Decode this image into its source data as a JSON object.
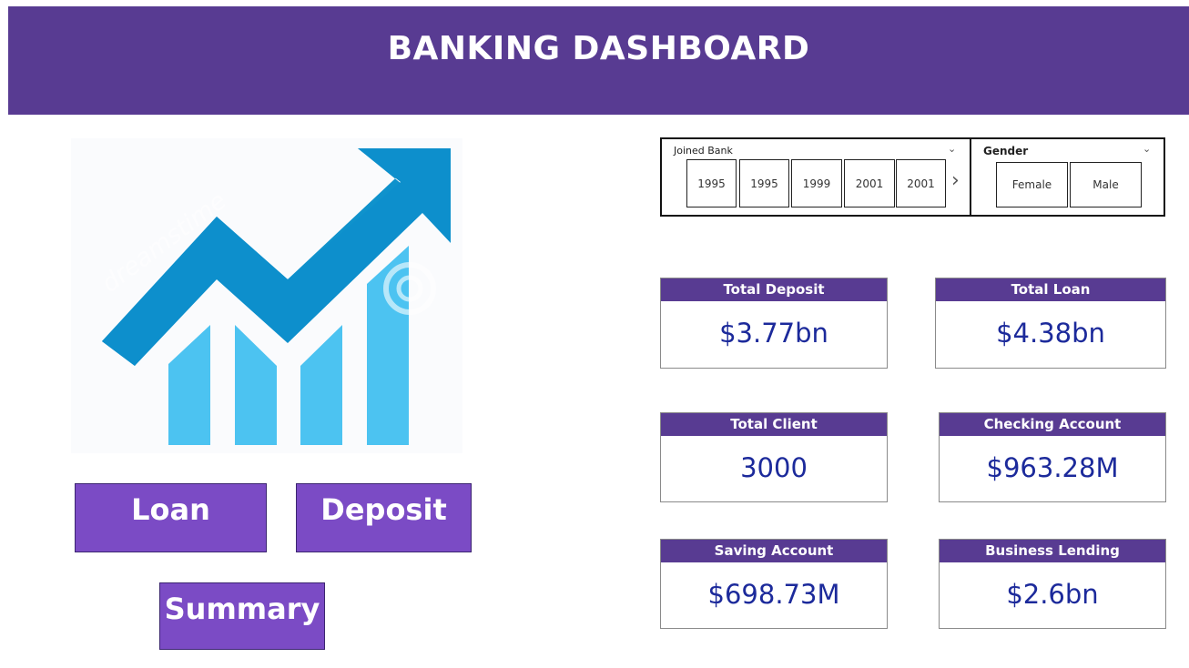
{
  "header": {
    "title": "BANKING DASHBOARD"
  },
  "logo": {
    "watermark": "dreamstime",
    "icon": "growth-chart-logo"
  },
  "nav": {
    "loan_label": "Loan",
    "deposit_label": "Deposit",
    "summary_label": "Summary"
  },
  "slicers": {
    "joined_bank": {
      "title": "Joined Bank",
      "options": [
        "1995",
        "1995",
        "1999",
        "2001",
        "2001"
      ]
    },
    "gender": {
      "title": "Gender",
      "options": [
        "Female",
        "Male"
      ]
    }
  },
  "cards": {
    "total_deposit": {
      "title": "Total Deposit",
      "value": "$3.77bn"
    },
    "total_loan": {
      "title": "Total Loan",
      "value": "$4.38bn"
    },
    "total_client": {
      "title": "Total Client",
      "value": "3000"
    },
    "checking_account": {
      "title": "Checking Account",
      "value": "$963.28M"
    },
    "saving_account": {
      "title": "Saving Account",
      "value": "$698.73M"
    },
    "business_lending": {
      "title": "Business Lending",
      "value": "$2.6bn"
    }
  },
  "colors": {
    "header": "#583b92",
    "button": "#7b4bc5",
    "value_text": "#1c2a9b",
    "chart_blue": "#4fc3f0",
    "arrow_blue": "#0d8fcc"
  }
}
